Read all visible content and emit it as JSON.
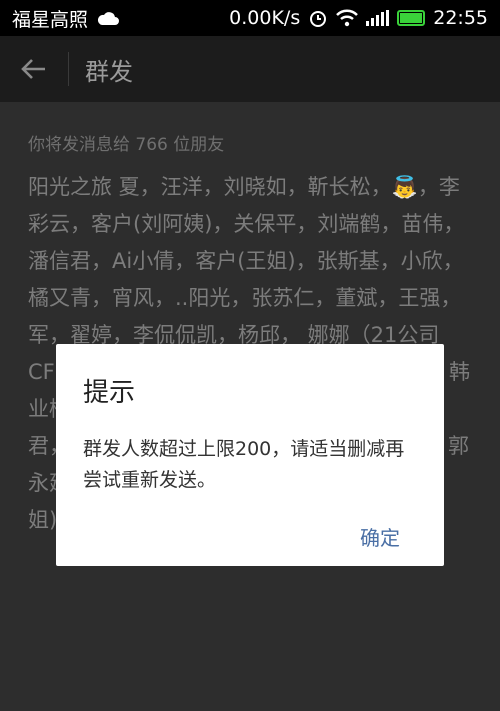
{
  "status_bar": {
    "carrier": "福星高照",
    "speed": "0.00K/s",
    "time": "22:55",
    "battery_level": 1.0,
    "icons": [
      "cloud-icon",
      "alarm-icon",
      "wifi-icon",
      "signal-icon",
      "battery-icon"
    ]
  },
  "title_bar": {
    "back_icon": "arrow-left-icon",
    "title": "群发"
  },
  "content": {
    "hint": "你将发消息给 766 位朋友",
    "recipients": "阳光之旅 夏，汪洋，刘晓如，靳长松，👼，李彩云，客户(刘阿姨)，关保平，刘端鹤，苗伟，潘信君，Ai小倩，客户(王姐)，张斯基，小欣，橘又青，宵风，..阳光，张苏仁，董斌，王强，军，翟婷，李侃侃凯，杨邱， 娜娜（21公司 CF 昭君，秀，钟 爱，李 灵儿，郭言 浅】*，韩业楠，微笑，死磕侠_十三，谭康，冰，周文君，芳韵，圆，张学秀，王舒正，北冥有鱼，郭永建，向敏， 🎷 wx，赵培，王謦，客户(刘姐)，花园酒店刘，潘芳，Jack，"
  },
  "dialog": {
    "title": "提示",
    "message": "群发人数超过上限200，请适当删减再尝试重新发送。",
    "confirm_label": "确定"
  },
  "colors": {
    "battery": "#3ad23a",
    "dialog_button": "#4a6fa5",
    "dim_background": "#2d2d2d"
  }
}
